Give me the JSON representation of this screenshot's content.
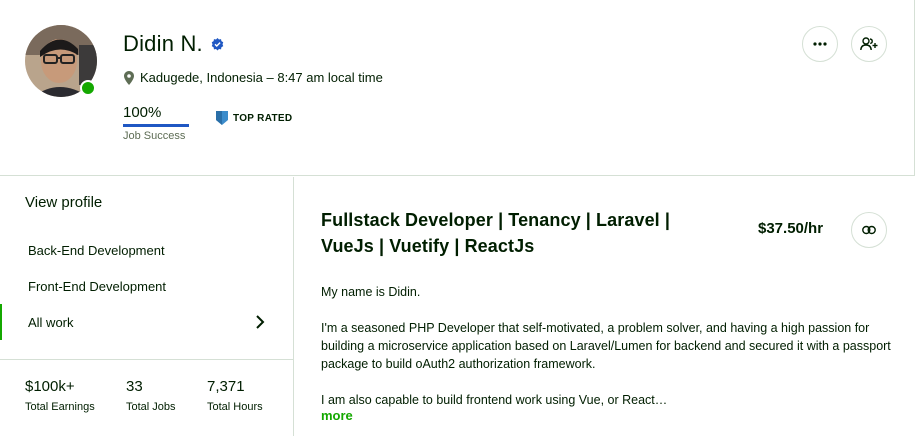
{
  "profile": {
    "name": "Didin N.",
    "location": "Kadugede, Indonesia – 8:47 am local time",
    "job_success_value": "100%",
    "job_success_label": "Job Success",
    "job_success_fraction": 1.0,
    "top_rated_label": "TOP RATED",
    "online_status": "online"
  },
  "sidebar": {
    "heading": "View profile",
    "items": [
      {
        "label": "Back-End Development"
      },
      {
        "label": "Front-End Development"
      },
      {
        "label": "All work"
      }
    ],
    "stats": [
      {
        "value": "$100k+",
        "label": "Total Earnings"
      },
      {
        "value": "33",
        "label": "Total Jobs"
      },
      {
        "value": "7,371",
        "label": "Total Hours"
      }
    ]
  },
  "main": {
    "title": "Fullstack Developer | Tenancy | Laravel | VueJs | Vuetify | ReactJs",
    "rate": "$37.50/hr",
    "description": [
      "My name is Didin.",
      "I'm a seasoned PHP Developer that self-motivated, a problem solver, and having a high passion for building a microservice application based on Laravel/Lumen for backend and secured it with a passport package to build oAuth2 authorization framework.",
      "I am also capable to build frontend work using Vue, or React…"
    ],
    "more_label": "more"
  },
  "icons": {
    "verified": "verified-badge-icon",
    "location": "map-pin-icon",
    "top_rated": "top-rated-badge-icon",
    "more": "ellipsis-icon",
    "invite": "add-user-icon",
    "chevron": "chevron-right-icon",
    "link": "link-icon"
  },
  "colors": {
    "accent_green": "#14a800",
    "verified_blue": "#1f57c3",
    "badge_blue": "#3c8ccb",
    "text": "#001e00",
    "muted": "#5e6d55",
    "border": "#d5e0d5"
  }
}
